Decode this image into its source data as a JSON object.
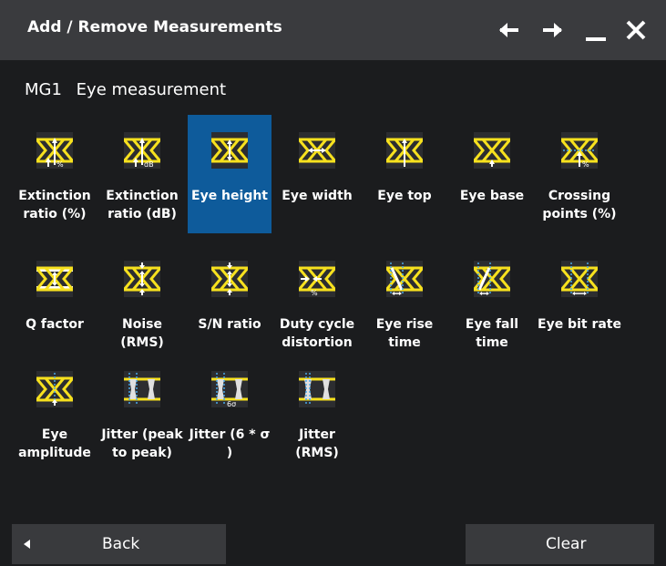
{
  "window": {
    "title": "Add / Remove Measurements",
    "icons": [
      "arrow-left-icon",
      "arrow-right-icon",
      "minimize-icon",
      "close-icon"
    ]
  },
  "header": {
    "group": "MG1",
    "category": "Eye measurement"
  },
  "colors": {
    "accent": "#f7e11e",
    "selected": "#0e5b9b",
    "marker": "#4aa8e8",
    "tile_bg": "#2c2d30"
  },
  "measurements": [
    {
      "label": "Extinction ratio (%)",
      "icon": "extinction-ratio-percent-icon",
      "selected": false
    },
    {
      "label": "Extinction ratio (dB)",
      "icon": "extinction-ratio-db-icon",
      "selected": false
    },
    {
      "label": "Eye height",
      "icon": "eye-height-icon",
      "selected": true
    },
    {
      "label": "Eye width",
      "icon": "eye-width-icon",
      "selected": false
    },
    {
      "label": "Eye top",
      "icon": "eye-top-icon",
      "selected": false
    },
    {
      "label": "Eye base",
      "icon": "eye-base-icon",
      "selected": false
    },
    {
      "label": "Crossing points (%)",
      "icon": "crossing-points-icon",
      "selected": false
    },
    {
      "label": "Q factor",
      "icon": "q-factor-icon",
      "selected": false
    },
    {
      "label": "Noise (RMS)",
      "icon": "noise-rms-icon",
      "selected": false
    },
    {
      "label": "S/N ratio",
      "icon": "sn-ratio-icon",
      "selected": false
    },
    {
      "label": "Duty cycle distortion",
      "icon": "duty-cycle-distortion-icon",
      "selected": false
    },
    {
      "label": "Eye rise time",
      "icon": "eye-rise-time-icon",
      "selected": false
    },
    {
      "label": "Eye fall time",
      "icon": "eye-fall-time-icon",
      "selected": false
    },
    {
      "label": "Eye bit rate",
      "icon": "eye-bit-rate-icon",
      "selected": false
    },
    {
      "label": "Eye amplitude",
      "icon": "eye-amplitude-icon",
      "selected": false
    },
    {
      "label": "Jitter (peak to peak)",
      "icon": "jitter-peak-to-peak-icon",
      "selected": false
    },
    {
      "label": "Jitter (6 * σ )",
      "icon": "jitter-6-sigma-icon",
      "selected": false
    },
    {
      "label": "Jitter (RMS)",
      "icon": "jitter-rms-icon",
      "selected": false
    }
  ],
  "icon_text": {
    "percent": "%",
    "db": "dB",
    "six_sigma": "6σ"
  },
  "footer": {
    "back_label": "Back",
    "clear_label": "Clear"
  }
}
